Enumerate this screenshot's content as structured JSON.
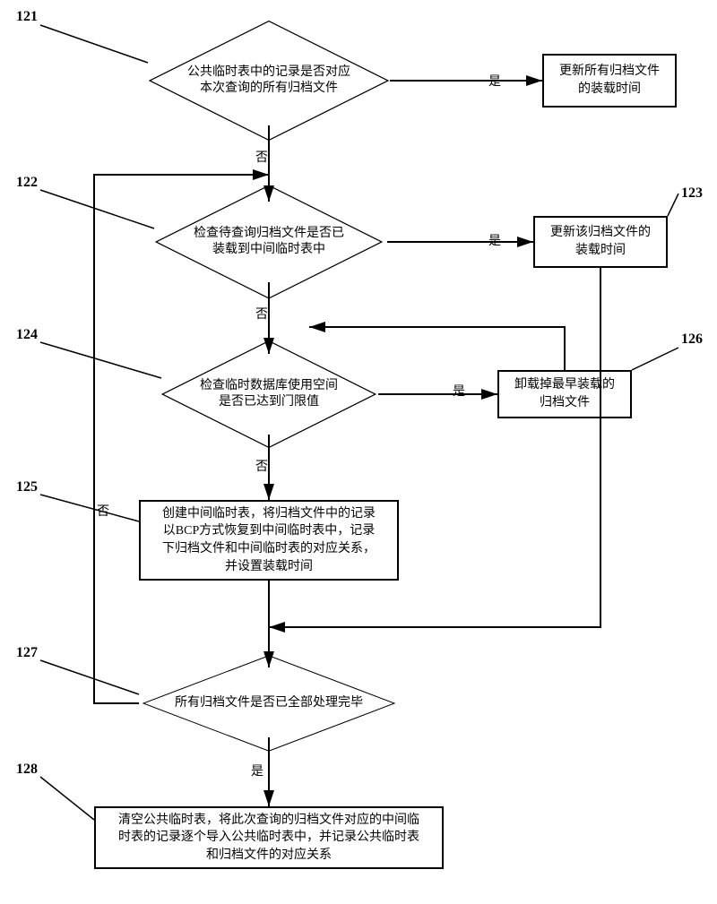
{
  "labels": {
    "l121": "121",
    "l122": "122",
    "l123": "123",
    "l124": "124",
    "l125": "125",
    "l126": "126",
    "l127": "127",
    "l128": "128"
  },
  "nodes": {
    "d121": "公共临时表中的记录是否对应\n本次查询的所有归档文件",
    "b121r": "更新所有归档文件\n的装载时间",
    "d122": "检查待查询归档文件是否已\n装载到中间临时表中",
    "b123": "更新该归档文件的\n装载时间",
    "d124": "检查临时数据库使用空间\n是否已达到门限值",
    "b126": "卸载掉最早装载的\n归档文件",
    "b125": "创建中间临时表，将归档文件中的记录\n以BCP方式恢复到中间临时表中，记录\n下归档文件和中间临时表的对应关系，\n并设置装载时间",
    "d127": "所有归档文件是否已全部处理完毕",
    "b128": "清空公共临时表，将此次查询的归档文件对应的中间临\n时表的记录逐个导入公共临时表中，并记录公共临时表\n和归档文件的对应关系"
  },
  "edges": {
    "yes": "是",
    "no": "否"
  },
  "chart_data": {
    "type": "flowchart",
    "nodes": [
      {
        "id": "121",
        "type": "decision",
        "text": "公共临时表中的记录是否对应本次查询的所有归档文件"
      },
      {
        "id": "121r",
        "type": "process",
        "text": "更新所有归档文件的装载时间"
      },
      {
        "id": "122",
        "type": "decision",
        "text": "检查待查询归档文件是否已装载到中间临时表中"
      },
      {
        "id": "123",
        "type": "process",
        "text": "更新该归档文件的装载时间"
      },
      {
        "id": "124",
        "type": "decision",
        "text": "检查临时数据库使用空间是否已达到门限值"
      },
      {
        "id": "125",
        "type": "process",
        "text": "创建中间临时表，将归档文件中的记录以BCP方式恢复到中间临时表中，记录下归档文件和中间临时表的对应关系，并设置装载时间"
      },
      {
        "id": "126",
        "type": "process",
        "text": "卸载掉最早装载的归档文件"
      },
      {
        "id": "127",
        "type": "decision",
        "text": "所有归档文件是否已全部处理完毕"
      },
      {
        "id": "128",
        "type": "process",
        "text": "清空公共临时表，将此次查询的归档文件对应的中间临时表的记录逐个导入公共临时表中，并记录公共临时表和归档文件的对应关系"
      }
    ],
    "edges": [
      {
        "from": "121",
        "to": "121r",
        "label": "是"
      },
      {
        "from": "121",
        "to": "122",
        "label": "否"
      },
      {
        "from": "122",
        "to": "123",
        "label": "是"
      },
      {
        "from": "122",
        "to": "124",
        "label": "否"
      },
      {
        "from": "123",
        "to": "127",
        "label": ""
      },
      {
        "from": "124",
        "to": "126",
        "label": "是"
      },
      {
        "from": "124",
        "to": "125",
        "label": "否"
      },
      {
        "from": "126",
        "to": "124",
        "label": ""
      },
      {
        "from": "125",
        "to": "127",
        "label": ""
      },
      {
        "from": "127",
        "to": "122",
        "label": "否"
      },
      {
        "from": "127",
        "to": "128",
        "label": "是"
      }
    ]
  }
}
